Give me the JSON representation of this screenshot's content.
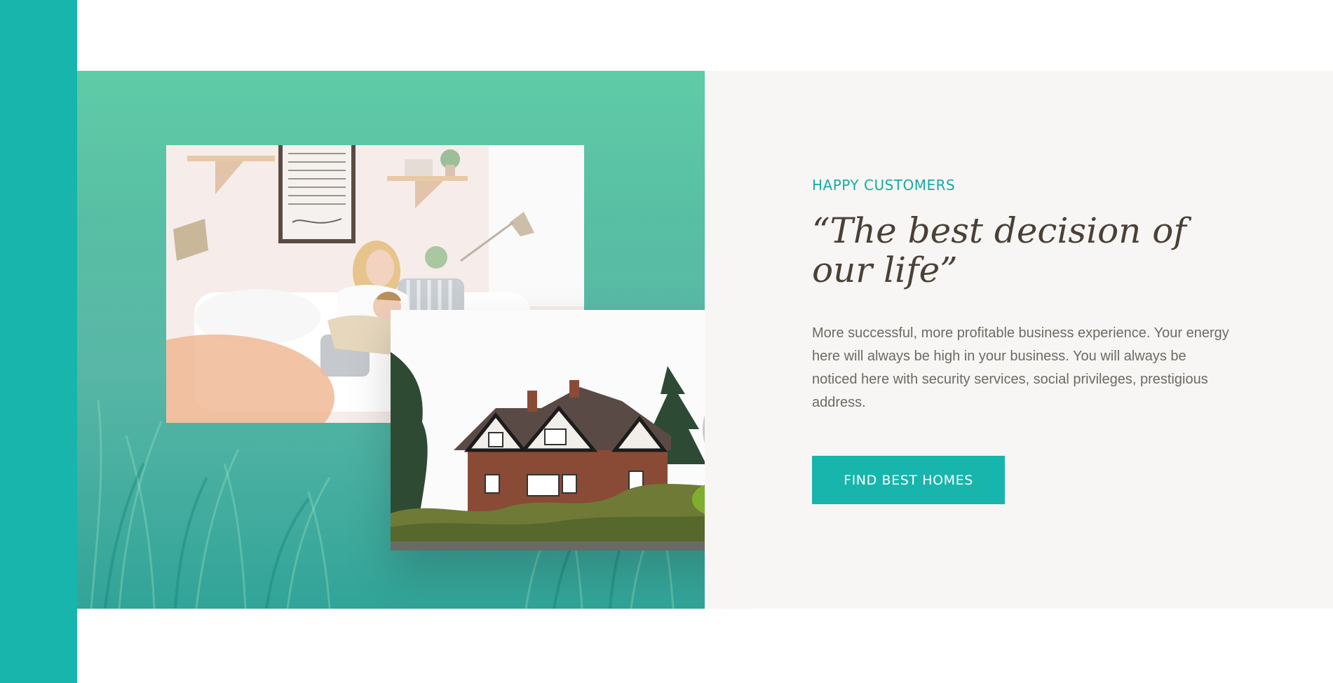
{
  "section": {
    "eyebrow": "HAPPY CUSTOMERS",
    "quote": "“The best decision of our life”",
    "description": "More successful, more profitable business experience. Your energy here will always be high in your business. You will always be noticed here with security services, social privileges, prestigious address.",
    "cta_label": "FIND BEST HOMES"
  },
  "images": {
    "family": "mother-and-child-living-room-photo",
    "house": "tudor-house-photo",
    "background": "grass-background-photo"
  },
  "colors": {
    "accent": "#17b5ab",
    "heading": "#4a4036",
    "body_text": "#6e6a64",
    "panel_bg": "#f7f6f4"
  }
}
